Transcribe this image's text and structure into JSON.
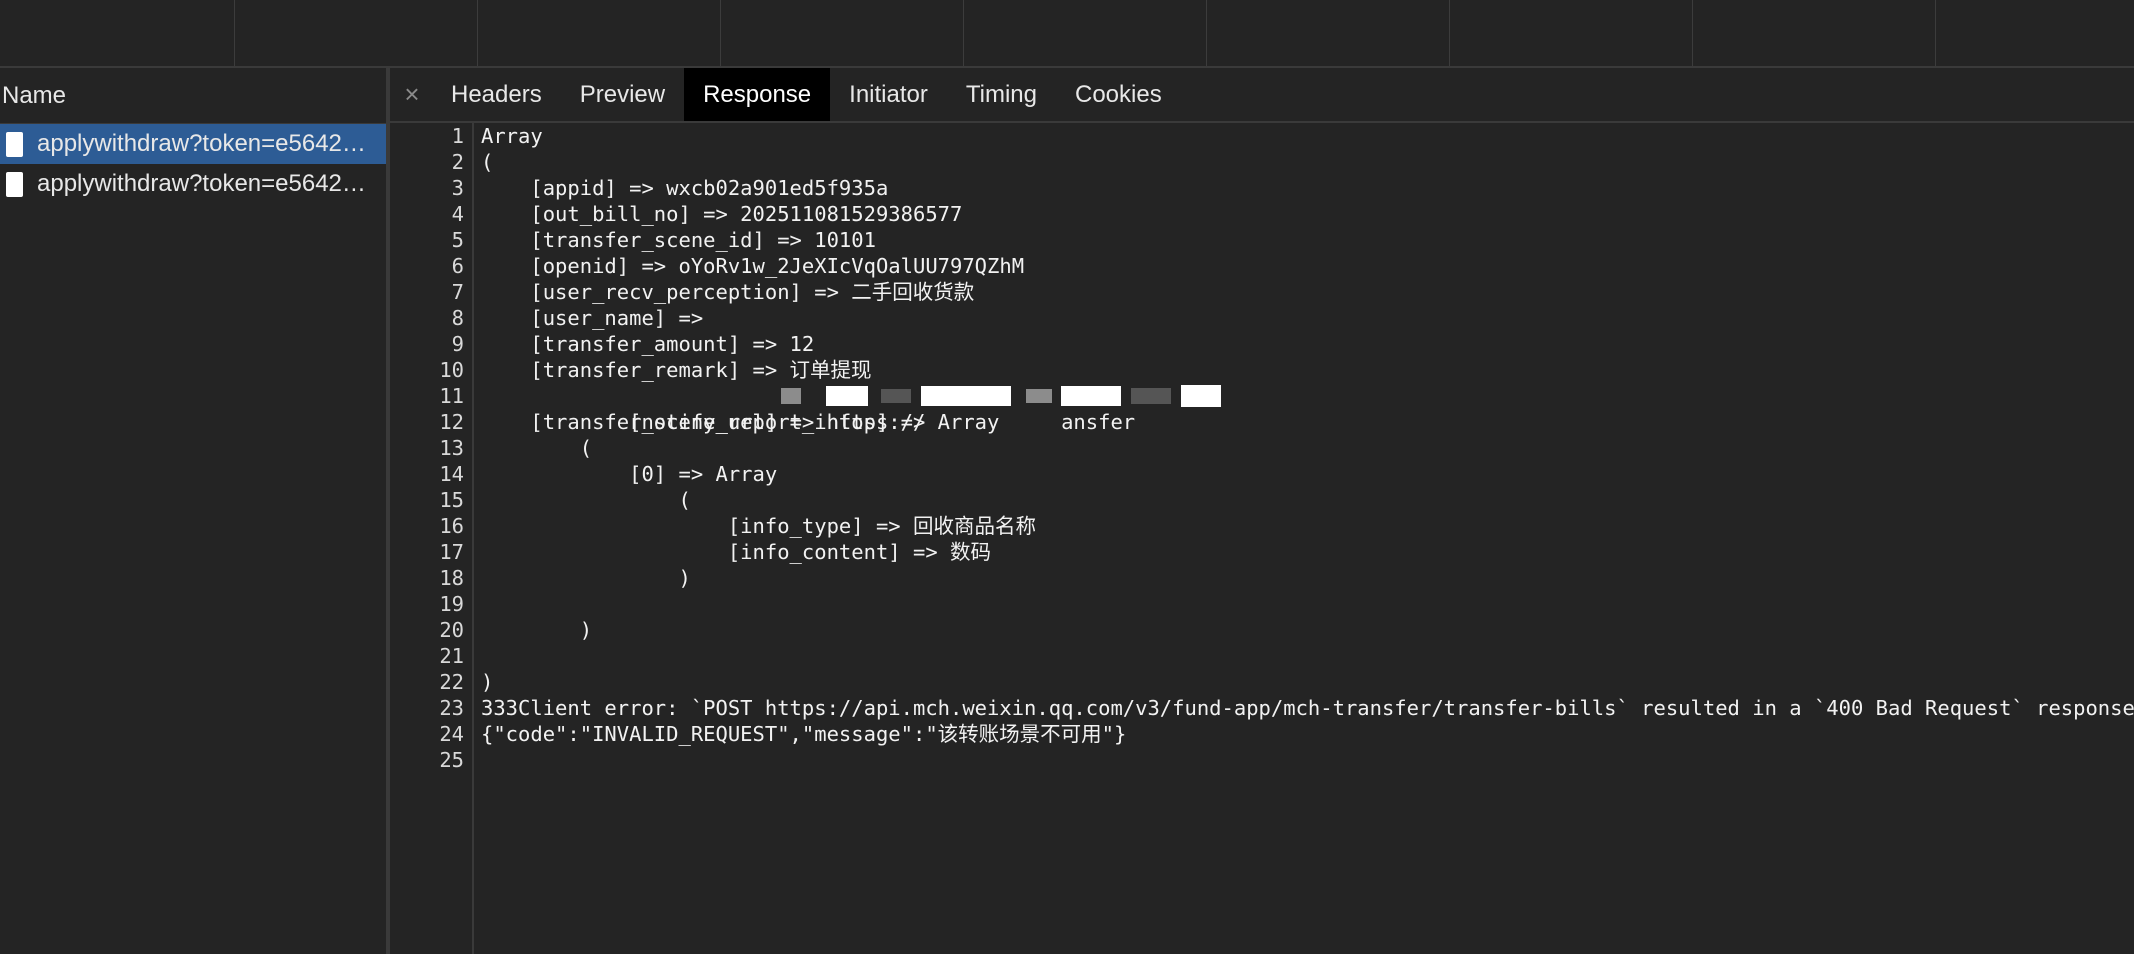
{
  "timeline": {
    "ticks": 9
  },
  "left_panel": {
    "header": "Name",
    "requests": [
      {
        "name": "applywithdraw?token=e5642…",
        "selected": true
      },
      {
        "name": "applywithdraw?token=e5642…",
        "selected": false
      }
    ]
  },
  "tabs": {
    "close_icon": "×",
    "items": [
      {
        "label": "Headers"
      },
      {
        "label": "Preview"
      },
      {
        "label": "Response",
        "active": true
      },
      {
        "label": "Initiator"
      },
      {
        "label": "Timing"
      },
      {
        "label": "Cookies"
      }
    ]
  },
  "response": {
    "line_numbers": [
      "1",
      "2",
      "3",
      "4",
      "5",
      "6",
      "7",
      "8",
      "9",
      "10",
      "11",
      "12",
      "13",
      "14",
      "15",
      "16",
      "17",
      "18",
      "19",
      "20",
      "21",
      "22",
      "23",
      "24",
      "25"
    ],
    "lines": [
      "Array",
      "(",
      "    [appid] => wxcb02a901ed5f935a",
      "    [out_bill_no] => 202511081529386577",
      "    [transfer_scene_id] => 10101",
      "    [openid] => oYoRv1w_2JeXIcVqOalUU797QZhM",
      "    [user_recv_perception] => 二手回收货款",
      "    [user_name] => ",
      "    [transfer_amount] => 12",
      "    [transfer_remark] => 订单提现",
      "    [notify_url] => https://           ansfer",
      "    [transfer_scene_report_infos] => Array",
      "        (",
      "            [0] => Array",
      "                (",
      "                    [info_type] => 回收商品名称",
      "                    [info_content] => 数码",
      "                )",
      "",
      "        )",
      "",
      ")",
      "333Client error: `POST https://api.mch.weixin.qq.com/v3/fund-app/mch-transfer/transfer-bills` resulted in a `400 Bad Request` response:",
      "{\"code\":\"INVALID_REQUEST\",\"message\":\"该转账场景不可用\"}",
      ""
    ]
  },
  "colors": {
    "background": "#242424",
    "selected_row": "#2d5c95",
    "active_tab": "#000000"
  }
}
